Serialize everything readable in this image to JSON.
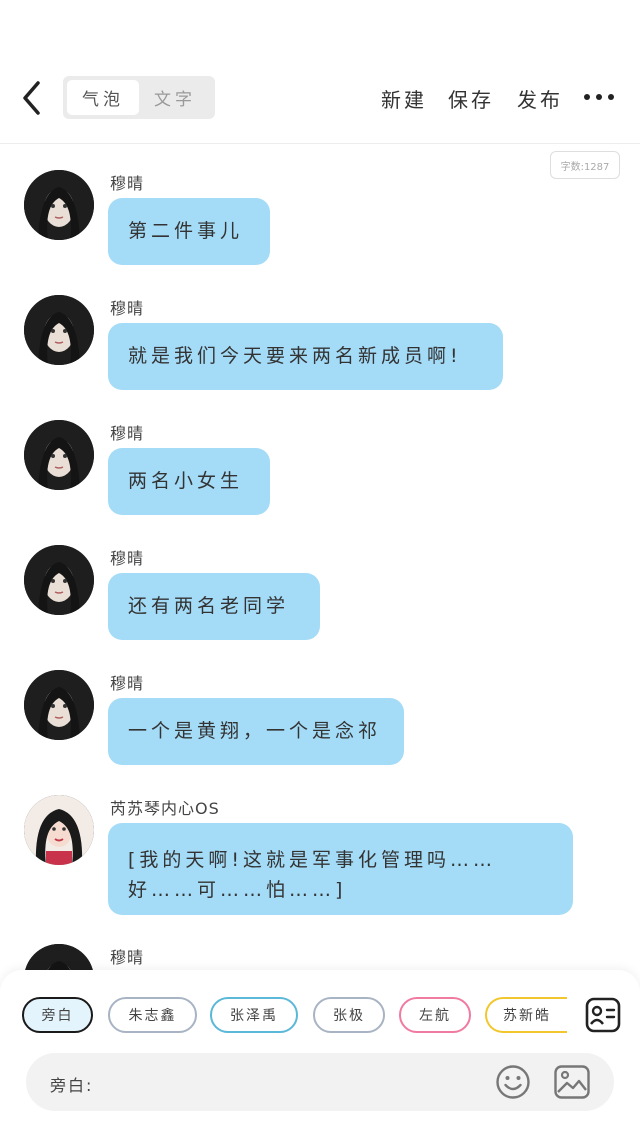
{
  "header": {
    "tabs": [
      {
        "label": "气泡",
        "active": true
      },
      {
        "label": "文字",
        "active": false
      }
    ],
    "actions": {
      "new": "新建",
      "save": "保存",
      "publish": "发布"
    }
  },
  "word_count": "字数:1287",
  "messages": [
    {
      "sender": "穆晴",
      "text": "第二件事儿"
    },
    {
      "sender": "穆晴",
      "text": "就是我们今天要来两名新成员啊!"
    },
    {
      "sender": "穆晴",
      "text": "两名小女生"
    },
    {
      "sender": "穆晴",
      "text": "还有两名老同学"
    },
    {
      "sender": "穆晴",
      "text": "一个是黄翔，一个是念祁"
    },
    {
      "sender": "芮苏琴内心OS",
      "text": "[我的天啊!这就是军事化管理吗……好……可……怕……]"
    },
    {
      "sender": "穆晴",
      "text": ""
    }
  ],
  "characters": [
    {
      "name": "旁白",
      "color": "#1a1a1a",
      "selected": true
    },
    {
      "name": "朱志鑫",
      "color": "#a8b4c4"
    },
    {
      "name": "张泽禹",
      "color": "#5bb8d8"
    },
    {
      "name": "张极",
      "color": "#a8b4c4"
    },
    {
      "name": "左航",
      "color": "#f07aa0"
    },
    {
      "name": "苏新皓",
      "color": "#f2c72e"
    }
  ],
  "input": {
    "label": "旁白:"
  },
  "colors": {
    "bubble": "#a4dcf8",
    "selected_chip_bg": "#e4f4fc"
  }
}
